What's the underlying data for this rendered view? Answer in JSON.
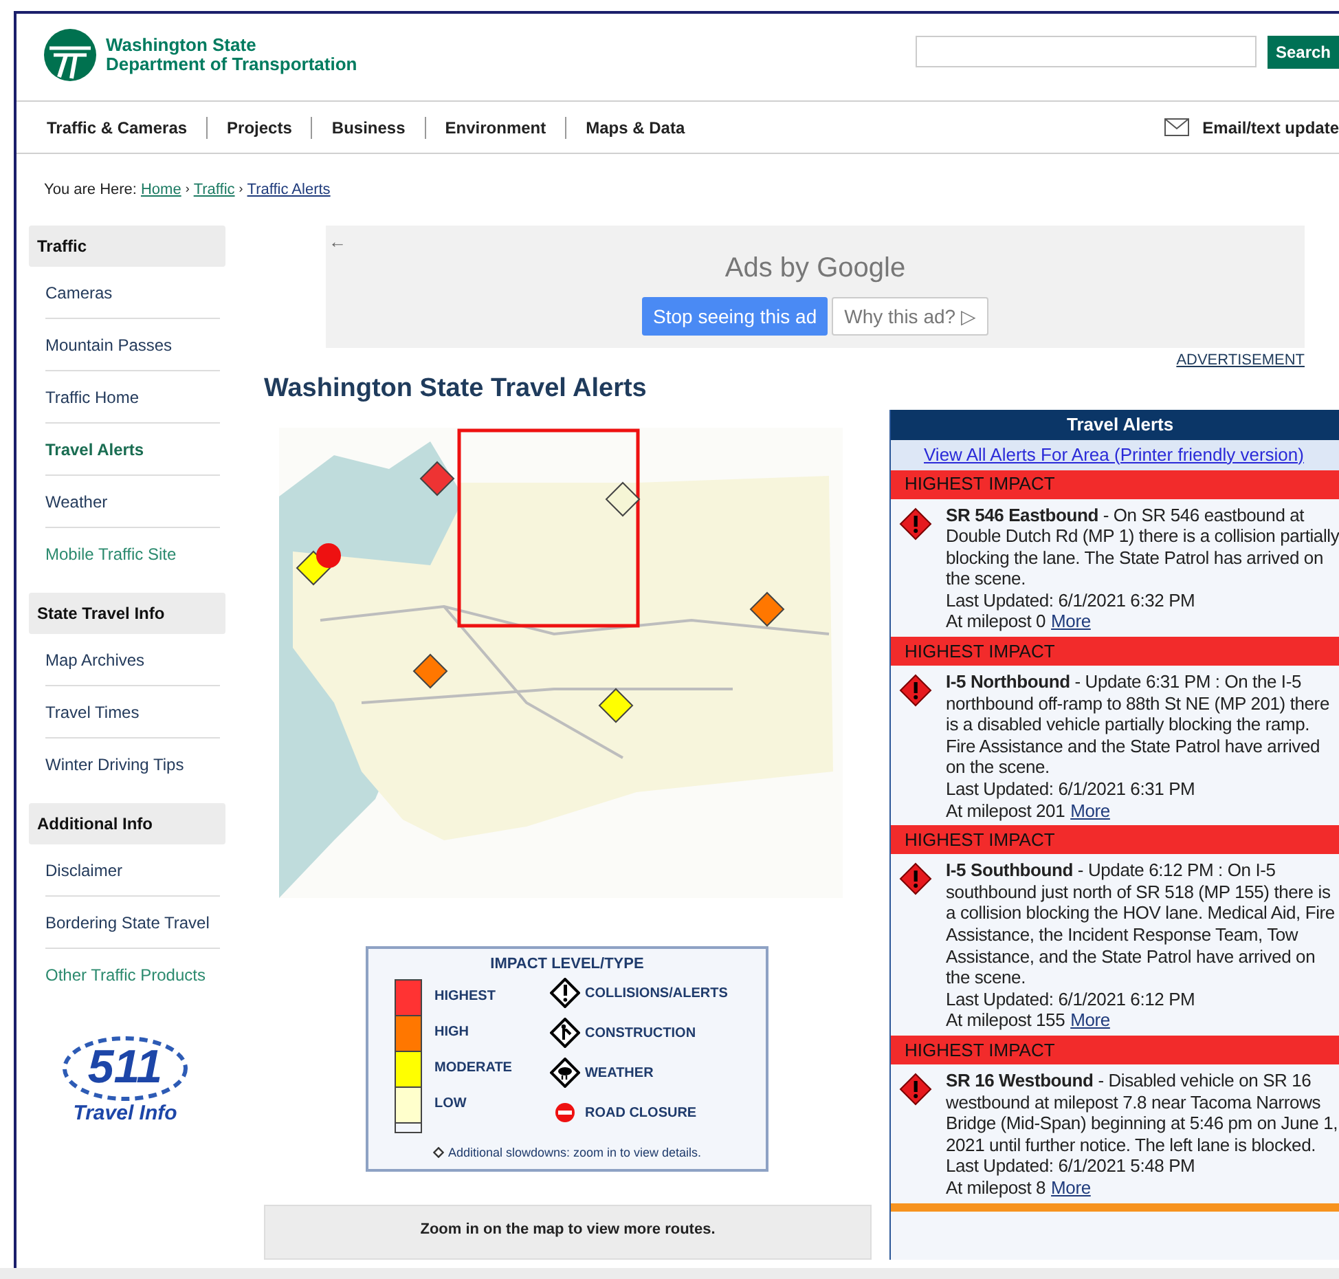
{
  "header": {
    "logo_line1": "Washington State",
    "logo_line2": "Department of Transportation",
    "search_button": "Search"
  },
  "nav": {
    "items": [
      "Traffic & Cameras",
      "Projects",
      "Business",
      "Environment",
      "Maps & Data"
    ],
    "email": "Email/text update"
  },
  "breadcrumb": {
    "prefix": "You are Here:",
    "separator": "›",
    "links": [
      "Home",
      "Traffic",
      "Traffic Alerts"
    ]
  },
  "sidebar": [
    {
      "title": "Traffic",
      "items": [
        {
          "label": "Cameras",
          "selected": false,
          "visited": false
        },
        {
          "label": "Mountain Passes",
          "selected": false,
          "visited": false
        },
        {
          "label": "Traffic Home",
          "selected": false,
          "visited": false
        },
        {
          "label": "Travel Alerts",
          "selected": true,
          "visited": false
        },
        {
          "label": "Weather",
          "selected": false,
          "visited": false
        },
        {
          "label": "Mobile Traffic Site",
          "selected": false,
          "visited": true
        }
      ]
    },
    {
      "title": "State Travel Info",
      "items": [
        {
          "label": "Map Archives",
          "selected": false,
          "visited": false
        },
        {
          "label": "Travel Times",
          "selected": false,
          "visited": false
        },
        {
          "label": "Winter Driving Tips",
          "selected": false,
          "visited": false
        }
      ]
    },
    {
      "title": "Additional Info",
      "items": [
        {
          "label": "Disclaimer",
          "selected": false,
          "visited": false
        },
        {
          "label": "Bordering State Travel",
          "selected": false,
          "visited": false
        },
        {
          "label": "Other Traffic Products",
          "selected": false,
          "visited": true
        }
      ]
    }
  ],
  "logo_511": {
    "number": "511",
    "caption": "Travel Info"
  },
  "ad": {
    "back": "←",
    "brand": "Ads by Google",
    "stop_button": "Stop seeing this ad",
    "why_button": "Why this ad? ▷",
    "label": "ADVERTISEMENT"
  },
  "page_title": "Washington State Travel Alerts",
  "legend": {
    "title": "IMPACT LEVEL/TYPE",
    "levels": [
      {
        "label": "HIGHEST",
        "color": "#ff3333"
      },
      {
        "label": "HIGH",
        "color": "#ff7700"
      },
      {
        "label": "MODERATE",
        "color": "#ffff00"
      },
      {
        "label": "LOW",
        "color": "#ffffcc"
      }
    ],
    "types": [
      {
        "label": "COLLISIONS/ALERTS",
        "kind": "alert"
      },
      {
        "label": "CONSTRUCTION",
        "kind": "construction"
      },
      {
        "label": "WEATHER",
        "kind": "weather"
      },
      {
        "label": "ROAD CLOSURE",
        "kind": "closure"
      }
    ],
    "note": "Additional slowdowns: zoom in to view details."
  },
  "zoom_note": "Zoom in on the map to view more routes.",
  "alerts": {
    "title": "Travel Alerts",
    "link": "View All Alerts For Area (Printer friendly version)",
    "items": [
      {
        "impact": "HIGHEST IMPACT",
        "text": "**SR 546 Eastbound** - On SR 546 eastbound at Double Dutch Rd (MP 1) there is a collision partially blocking the lane. The State Patrol has arrived on the scene.",
        "updated": "Last Updated: 6/1/2021 6:32 PM",
        "milepost": "At milepost 0",
        "more": "More"
      },
      {
        "impact": "HIGHEST IMPACT",
        "text": "**I-5 Northbound** - Update 6:31 PM : On the I-5 northbound off-ramp to 88th St NE (MP 201) there is a disabled vehicle partially blocking the ramp. Fire Assistance and the State Patrol have arrived on the scene.",
        "updated": "Last Updated: 6/1/2021 6:31 PM",
        "milepost": "At milepost 201",
        "more": "More"
      },
      {
        "impact": "HIGHEST IMPACT",
        "text": "**I-5 Southbound** - Update 6:12 PM : On I-5 southbound just north of SR 518 (MP 155) there is a collision blocking the HOV lane. Medical Aid, Fire Assistance, the Incident Response Team, Tow Assistance, and the State Patrol have arrived on the scene.",
        "updated": "Last Updated: 6/1/2021 6:12 PM",
        "milepost": "At milepost 155",
        "more": "More"
      },
      {
        "impact": "HIGHEST IMPACT",
        "text": "**SR 16 Westbound** - Disabled vehicle on SR 16 westbound at milepost 7.8 near Tacoma Narrows Bridge (Mid-Span) beginning at 5:46 pm on June 1, 2021 until further notice. The left lane is blocked.",
        "updated": "Last Updated: 6/1/2021 5:48 PM",
        "milepost": "At milepost 8",
        "more": "More"
      }
    ]
  }
}
